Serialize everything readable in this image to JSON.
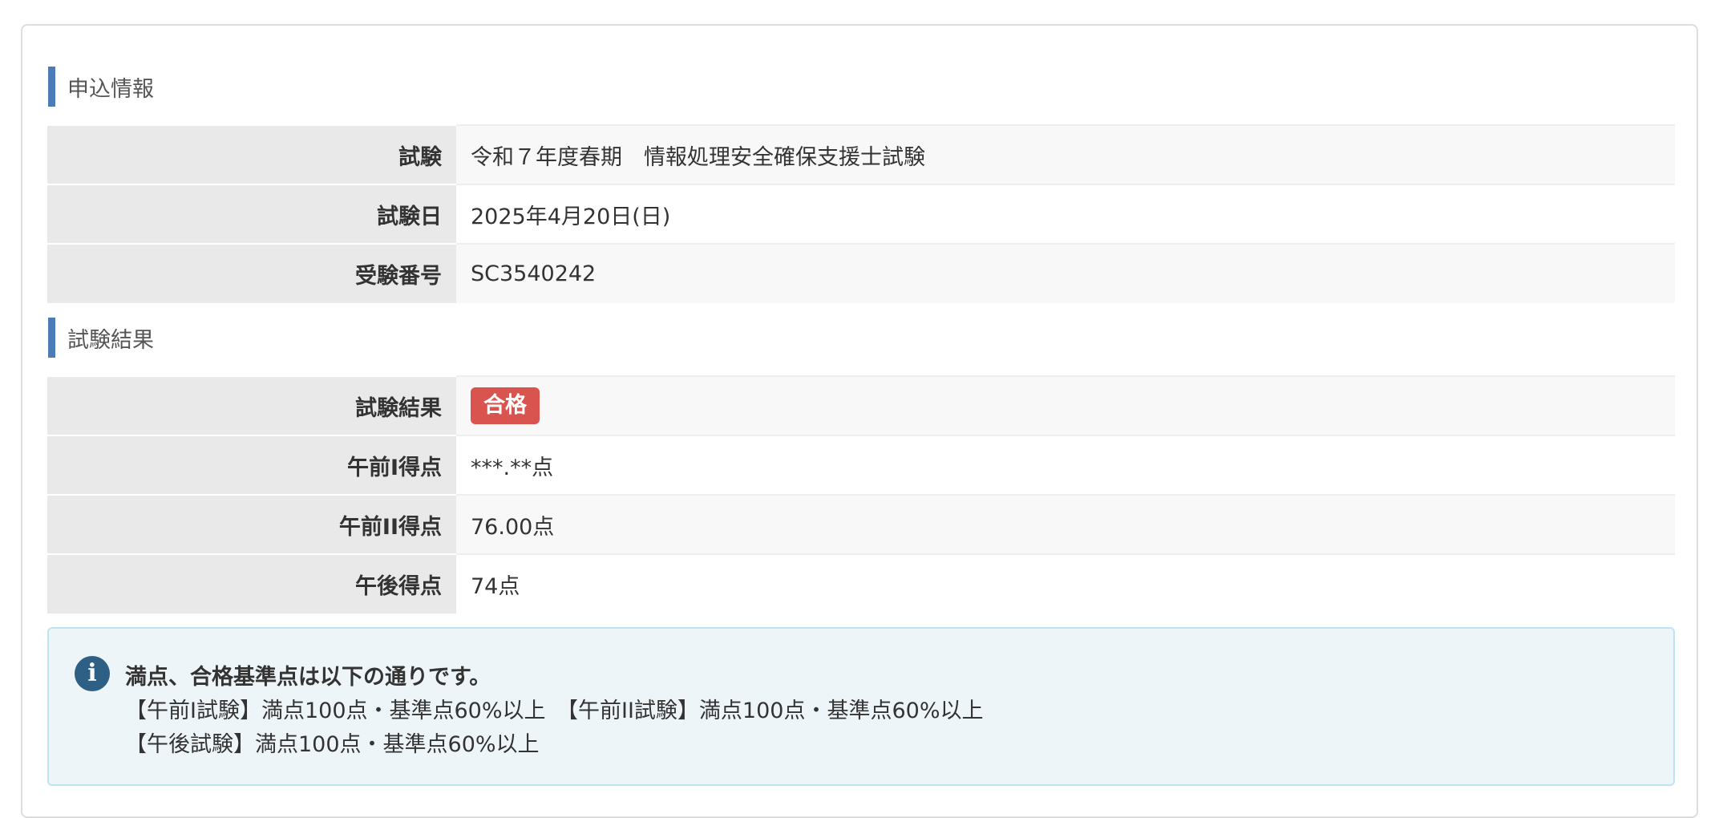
{
  "application": {
    "heading": "申込情報",
    "rows": [
      {
        "label": "試験",
        "value": "令和７年度春期　情報処理安全確保支援士試験"
      },
      {
        "label": "試験日",
        "value": "2025年4月20日(日)"
      },
      {
        "label": "受験番号",
        "value": "SC3540242"
      }
    ]
  },
  "result": {
    "heading": "試験結果",
    "status_label": "試験結果",
    "status_badge": "合格",
    "status_color": "#d9534f",
    "rows": [
      {
        "label": "午前I得点",
        "value": "***.**点"
      },
      {
        "label": "午前II得点",
        "value": "76.00点"
      },
      {
        "label": "午後得点",
        "value": "74点"
      }
    ]
  },
  "notice": {
    "icon": "info-icon",
    "icon_glyph": "i",
    "title": "満点、合格基準点は以下の通りです。",
    "line1": "【午前I試験】満点100点・基準点60%以上　【午前II試験】満点100点・基準点60%以上",
    "line2": "【午後試験】満点100点・基準点60%以上"
  },
  "colors": {
    "accent_bar": "#4c7cb8",
    "label_bg": "#e9e9e9",
    "notice_bg": "#eef5f9",
    "notice_border": "#bce4f2",
    "icon_color": "#2e5f84"
  }
}
